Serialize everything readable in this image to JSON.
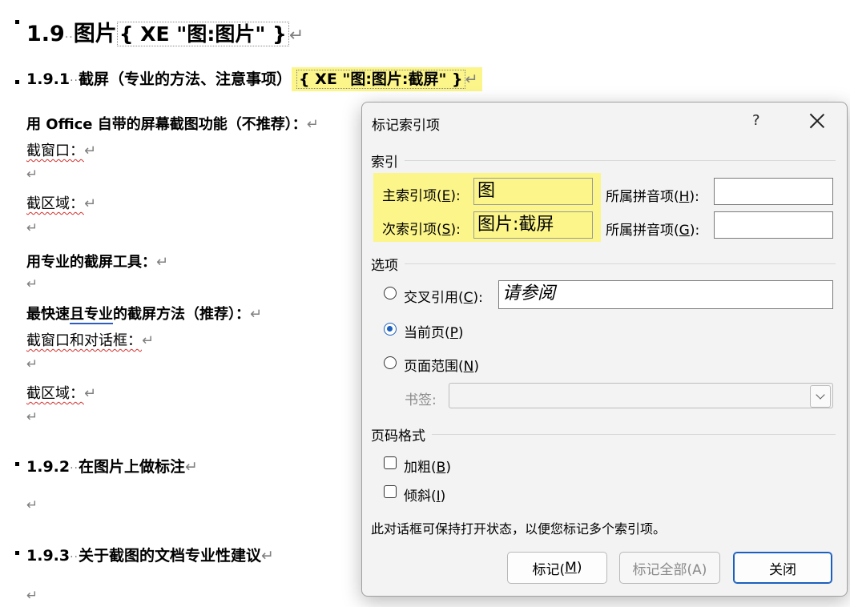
{
  "document": {
    "heading1": {
      "number": "1.9",
      "title": "图片",
      "field_code": "{ XE \"图:图片\" }"
    },
    "heading_191": {
      "number": "1.9.1",
      "title": "截屏（专业的方法、注意事项）",
      "field_code": "{ XE \"图:图片:截屏\" }"
    },
    "p1": "用 Office 自带的屏幕截图功能（不推荐）：",
    "p2": "截窗口：",
    "p3": "截区域：",
    "p4": "用专业的截屏工具：",
    "p5_a": "最快速",
    "p5_b": "且专业",
    "p5_c": "的截屏方法（推荐）：",
    "p6": "截窗口和对话框：",
    "p7": "截区域：",
    "heading_192": {
      "number": "1.9.2",
      "title": "在图片上做标注"
    },
    "heading_193": {
      "number": "1.9.3",
      "title": "关于截图的文档专业性建议"
    },
    "para_mark": "↵",
    "dots": "··"
  },
  "dialog": {
    "title": "标记索引项",
    "help": "?",
    "section_index": "索引",
    "main_entry_label": "主索引项(",
    "main_entry_key": "E",
    "main_entry_value": "图",
    "sub_entry_label": "次索引项(",
    "sub_entry_key": "S",
    "sub_entry_value": "图片:截屏",
    "pinyin_main_label": "所属拼音项(",
    "pinyin_main_key": "H",
    "pinyin_sub_label": "所属拼音项(",
    "pinyin_sub_key": "G",
    "close_paren": "):",
    "section_options": "选项",
    "cross_ref_label": "交叉引用(",
    "cross_ref_key": "C",
    "cross_ref_value": "请参阅",
    "current_page_label": "当前页(",
    "current_page_key": "P",
    "page_range_label": "页面范围(",
    "page_range_key": "N",
    "bookmark_label": "书签:",
    "section_format": "页码格式",
    "bold_label": "加粗(",
    "bold_key": "B",
    "italic_label": "倾斜(",
    "italic_key": "I",
    "paren_close": ")",
    "note": "此对话框可保持打开状态，以便您标记多个索引项。",
    "btn_mark_label": "标记(",
    "btn_mark_key": "M",
    "btn_mark_all": "标记全部(A)",
    "btn_close": "关闭",
    "selected_option": "current_page",
    "accent_color": "#1b5fbf",
    "highlight_color": "#fbf58a"
  }
}
